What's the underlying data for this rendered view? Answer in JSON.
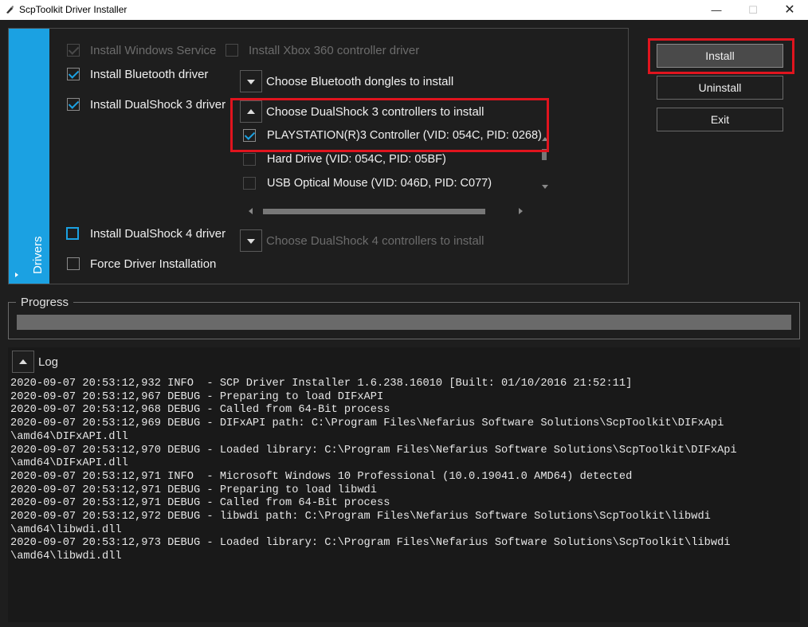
{
  "window": {
    "title": "ScpToolkit Driver Installer",
    "controls": {
      "minimize": "—",
      "maximize": "☐",
      "close": "✕"
    }
  },
  "drivers": {
    "tab_label": "Drivers",
    "options": {
      "windows_service": {
        "label": "Install Windows Service",
        "checked": true,
        "enabled": false
      },
      "xbox360": {
        "label": "Install Xbox 360 controller driver",
        "checked": false,
        "enabled": false
      },
      "bluetooth": {
        "label": "Install Bluetooth driver",
        "checked": true,
        "enabled": true
      },
      "dualshock3": {
        "label": "Install DualShock 3 driver",
        "checked": true,
        "enabled": true
      },
      "dualshock4": {
        "label": "Install DualShock 4 driver",
        "checked": false,
        "enabled": true
      },
      "force": {
        "label": "Force Driver Installation",
        "checked": false,
        "enabled": true
      }
    },
    "bt_dongles_label": "Choose Bluetooth dongles to install",
    "ds3_label": "Choose DualShock 3 controllers to install",
    "ds4_label": "Choose DualShock 4 controllers to install",
    "ds3_devices": [
      {
        "label": "PLAYSTATION(R)3 Controller (VID: 054C, PID: 0268)",
        "checked": true
      },
      {
        "label": "Hard Drive (VID: 054C, PID: 05BF)",
        "checked": false
      },
      {
        "label": "USB Optical Mouse (VID: 046D, PID: C077)",
        "checked": false
      }
    ]
  },
  "buttons": {
    "install": "Install",
    "uninstall": "Uninstall",
    "exit": "Exit"
  },
  "progress": {
    "title": "Progress",
    "value": 0
  },
  "log": {
    "title": "Log",
    "lines": [
      "2020-09-07 20:53:12,932 INFO  - SCP Driver Installer 1.6.238.16010 [Built: 01/10/2016 21:52:11]",
      "2020-09-07 20:53:12,967 DEBUG - Preparing to load DIFxAPI",
      "2020-09-07 20:53:12,968 DEBUG - Called from 64-Bit process",
      "2020-09-07 20:53:12,969 DEBUG - DIFxAPI path: C:\\Program Files\\Nefarius Software Solutions\\ScpToolkit\\DIFxApi",
      "\\amd64\\DIFxAPI.dll",
      "2020-09-07 20:53:12,970 DEBUG - Loaded library: C:\\Program Files\\Nefarius Software Solutions\\ScpToolkit\\DIFxApi",
      "\\amd64\\DIFxAPI.dll",
      "2020-09-07 20:53:12,971 INFO  - Microsoft Windows 10 Professional (10.0.19041.0 AMD64) detected",
      "2020-09-07 20:53:12,971 DEBUG - Preparing to load libwdi",
      "2020-09-07 20:53:12,971 DEBUG - Called from 64-Bit process",
      "2020-09-07 20:53:12,972 DEBUG - libwdi path: C:\\Program Files\\Nefarius Software Solutions\\ScpToolkit\\libwdi",
      "\\amd64\\libwdi.dll",
      "2020-09-07 20:53:12,973 DEBUG - Loaded library: C:\\Program Files\\Nefarius Software Solutions\\ScpToolkit\\libwdi",
      "\\amd64\\libwdi.dll"
    ]
  }
}
